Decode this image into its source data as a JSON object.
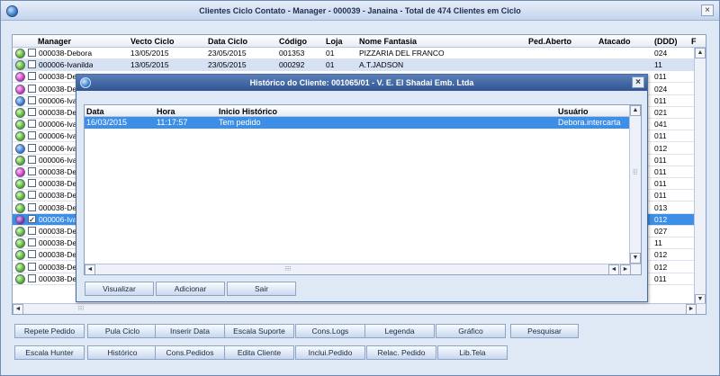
{
  "window": {
    "title": "Clientes Ciclo Contato - Manager - 000039 - Janaina - Total de      474 Clientes em Ciclo",
    "close": "×"
  },
  "grid": {
    "columns": [
      "Manager",
      "Vecto Ciclo",
      "Data Ciclo",
      "Código",
      "Loja",
      "Nome Fantasia",
      "Ped.Aberto",
      "Atacado",
      "(DDD)",
      "F"
    ],
    "rows": [
      {
        "status": "green",
        "checked": "",
        "manager": "000038-Debora",
        "vecto": "13/05/2015",
        "data": "23/05/2015",
        "codigo": "001353",
        "loja": "01",
        "nome": "PIZZARIA DEL FRANCO",
        "ddd": "024",
        "f": ""
      },
      {
        "status": "green",
        "checked": "",
        "manager": "000006-Ivanilda",
        "vecto": "13/05/2015",
        "data": "23/05/2015",
        "codigo": "000292",
        "loja": "01",
        "nome": "A.T.JADSON",
        "ddd": "11",
        "f": ""
      },
      {
        "status": "pink",
        "checked": "",
        "manager": "000038-De",
        "ddd": "011",
        "f": ""
      },
      {
        "status": "pink",
        "checked": "",
        "manager": "000038-De",
        "ddd": "024",
        "f": ""
      },
      {
        "status": "blue",
        "checked": "",
        "manager": "000006-Iva",
        "ddd": "011",
        "f": ""
      },
      {
        "status": "green",
        "checked": "",
        "manager": "000038-De",
        "ddd": "021",
        "f": ""
      },
      {
        "status": "green",
        "checked": "",
        "manager": "000006-Iva",
        "ddd": "041",
        "f": ""
      },
      {
        "status": "green",
        "checked": "",
        "manager": "000006-Iva",
        "ddd": "011",
        "f": ""
      },
      {
        "status": "blue",
        "checked": "",
        "manager": "000006-Iva",
        "ddd": "012",
        "f": ""
      },
      {
        "status": "green",
        "checked": "",
        "manager": "000006-Iva",
        "ddd": "011",
        "f": ""
      },
      {
        "status": "pink",
        "checked": "",
        "manager": "000038-De",
        "ddd": "011",
        "f": ""
      },
      {
        "status": "green",
        "checked": "",
        "manager": "000038-De",
        "ddd": "011",
        "f": ""
      },
      {
        "status": "green",
        "checked": "",
        "manager": "000038-De",
        "ddd": "011",
        "f": ""
      },
      {
        "status": "green",
        "checked": "",
        "manager": "000038-De",
        "ddd": "013",
        "f": ""
      },
      {
        "status": "purple",
        "checked": "✓",
        "manager": "000006-Iva",
        "ddd": "012",
        "f": ""
      },
      {
        "status": "green",
        "checked": "",
        "manager": "000038-De",
        "ddd": "027",
        "f": ""
      },
      {
        "status": "green",
        "checked": "",
        "manager": "000038-De",
        "ddd": "11",
        "f": ""
      },
      {
        "status": "green",
        "checked": "",
        "manager": "000038-De",
        "ddd": "012",
        "f": ""
      },
      {
        "status": "green",
        "checked": "",
        "manager": "000038-De",
        "ddd": "012",
        "f": ""
      },
      {
        "status": "green",
        "checked": "",
        "manager": "000038-De",
        "ddd": "011",
        "f": ""
      }
    ],
    "edge_marks": [
      "A",
      "0",
      "",
      "",
      "A",
      "0",
      "A",
      "",
      "",
      "",
      ""
    ]
  },
  "dialog": {
    "title": "Histórico do Cliente: 001065/01 - V. E. El Shadai Emb. Ltda",
    "close": "×",
    "columns": [
      "Data",
      "Hora",
      "Inicio Histórico",
      "Usuário"
    ],
    "rows": [
      {
        "data": "16/03/2015",
        "hora": "11:17:57",
        "historico": "Tem pedido",
        "usuario": "Debora.intercarta"
      }
    ],
    "buttons": [
      "Visualizar",
      "Adicionar",
      "Sair"
    ]
  },
  "buttons_row1": [
    "Repete Pedido",
    "Pula Ciclo",
    "Inserir Data",
    "Escala Suporte",
    "Cons.Logs",
    "Legenda",
    "Gráfico",
    "Pesquisar"
  ],
  "buttons_row2": [
    "Escala Hunter",
    "Histórico",
    "Cons.Pedidos",
    "Edita Cliente",
    "Inclui.Pedido",
    "Relac. Pedido",
    "Lib.Tela"
  ],
  "scroll_glyphs": {
    "up": "▲",
    "down": "▼",
    "left": "◄",
    "right": "►",
    "grip": "⠿⠿"
  }
}
